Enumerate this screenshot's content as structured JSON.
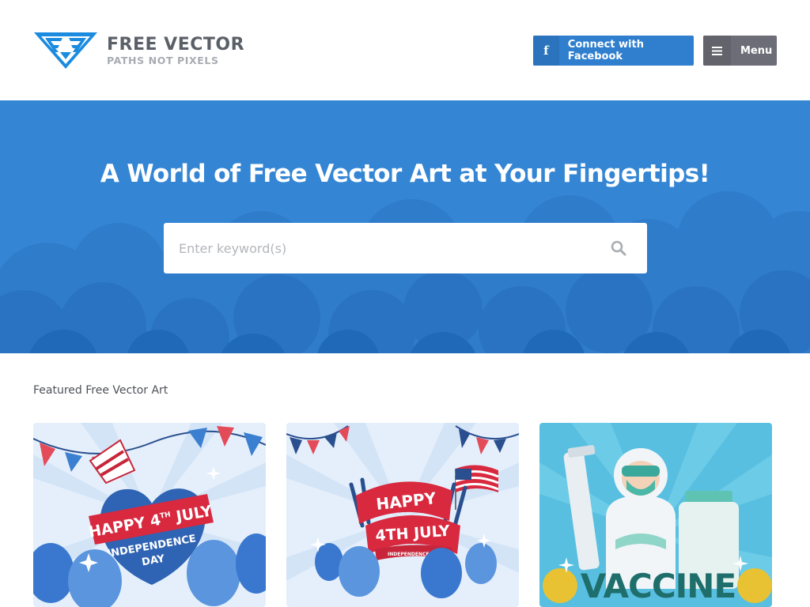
{
  "header": {
    "logo": {
      "title": "FREE VECTOR",
      "tagline": "PATHS NOT PIXELS"
    },
    "facebook_button": {
      "icon": "facebook-icon",
      "label": "Connect with Facebook"
    },
    "menu_button": {
      "icon": "hamburger-icon",
      "label": "Menu"
    }
  },
  "hero": {
    "title": "A World of Free Vector Art at Your Fingertips!",
    "search": {
      "placeholder": "Enter keyword(s)",
      "value": "",
      "icon": "search-icon"
    }
  },
  "featured": {
    "heading": "Featured Free Vector Art",
    "cards": [
      {
        "line1": "HAPPY 4",
        "sup": "TH",
        "line1b": "JULY",
        "line2": "INDEPENDENCE",
        "line3": "DAY"
      },
      {
        "line1": "HAPPY",
        "line2": "4TH JULY",
        "line3": "INDEPENDENCE DAY"
      },
      {
        "title": "VACCINE"
      }
    ]
  },
  "colors": {
    "brand_blue": "#2f7fce",
    "hero_blue": "#3486d4",
    "menu_gray": "#6c6d76",
    "logo_text": "#5b6068",
    "ribbon_red": "#d8293f",
    "vaccine_teal": "#1e6e6c"
  }
}
